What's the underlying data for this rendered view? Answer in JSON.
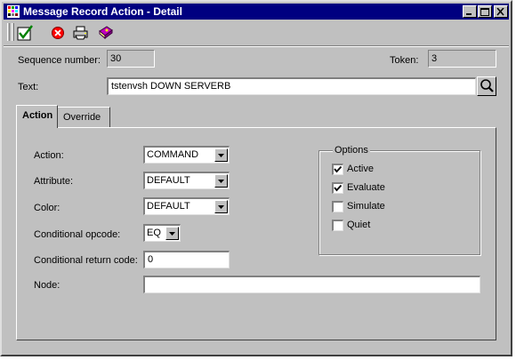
{
  "window": {
    "title": "Message Record Action - Detail"
  },
  "titlebar_buttons": {
    "minimize": "minimize-icon",
    "maximize": "maximize-icon",
    "close": "close-icon"
  },
  "toolbar": {
    "tools": [
      {
        "name": "ok-checkmark-icon",
        "color": "#008000"
      },
      {
        "name": "cancel-icon",
        "color": "#ff0000"
      },
      {
        "name": "print-icon",
        "color": "#000000"
      },
      {
        "name": "help-book-icon",
        "color": "#800080"
      }
    ]
  },
  "header": {
    "sequence_label": "Sequence number:",
    "sequence_value": "30",
    "token_label": "Token:",
    "token_value": "3",
    "text_label": "Text:",
    "text_value": "tstenvsh DOWN SERVERB"
  },
  "tabs": [
    {
      "label": "Action",
      "active": true
    },
    {
      "label": "Override",
      "active": false
    }
  ],
  "form": {
    "action_label": "Action:",
    "action_value": "COMMAND",
    "attribute_label": "Attribute:",
    "attribute_value": "DEFAULT",
    "color_label": "Color:",
    "color_value": "DEFAULT",
    "opcode_label": "Conditional opcode:",
    "opcode_value": "EQ",
    "return_code_label": "Conditional return code:",
    "return_code_value": "0",
    "node_label": "Node:",
    "node_value": ""
  },
  "options": {
    "title": "Options",
    "items": [
      {
        "label": "Active",
        "checked": true
      },
      {
        "label": "Evaluate",
        "checked": true
      },
      {
        "label": "Simulate",
        "checked": false
      },
      {
        "label": "Quiet",
        "checked": false
      }
    ]
  }
}
